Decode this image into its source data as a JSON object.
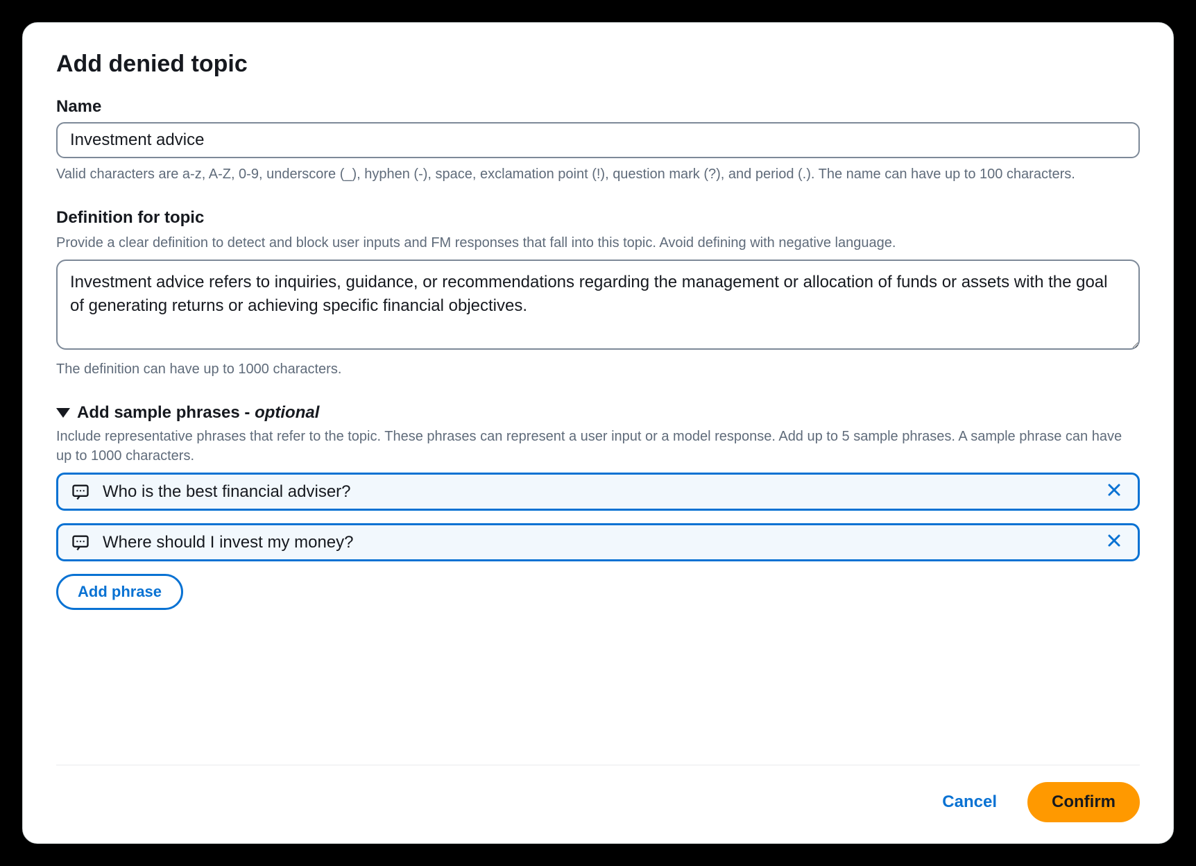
{
  "modal": {
    "title": "Add denied topic",
    "name": {
      "label": "Name",
      "value": "Investment advice",
      "helper": "Valid characters are a-z, A-Z, 0-9, underscore (_), hyphen (-), space, exclamation point (!), question mark (?), and period (.). The name can have up to 100 characters."
    },
    "definition": {
      "label": "Definition for topic",
      "sublabel": "Provide a clear definition to detect and block user inputs and FM responses that fall into this topic. Avoid defining with negative language.",
      "value": "Investment advice refers to inquiries, guidance, or recommendations regarding the management or allocation of funds or assets with the goal of generating returns or achieving specific financial objectives.",
      "helper": "The definition can have up to 1000 characters."
    },
    "samplePhrases": {
      "titlePrefix": "Add sample phrases - ",
      "titleOptional": "optional",
      "sublabel": "Include representative phrases that refer to the topic. These phrases can represent a user input or a model response. Add up to 5 sample phrases. A sample phrase can have up to 1000 characters.",
      "phrases": [
        "Who is the best financial adviser?",
        "Where should I invest my money?"
      ],
      "addButton": "Add phrase"
    },
    "footer": {
      "cancel": "Cancel",
      "confirm": "Confirm"
    }
  }
}
